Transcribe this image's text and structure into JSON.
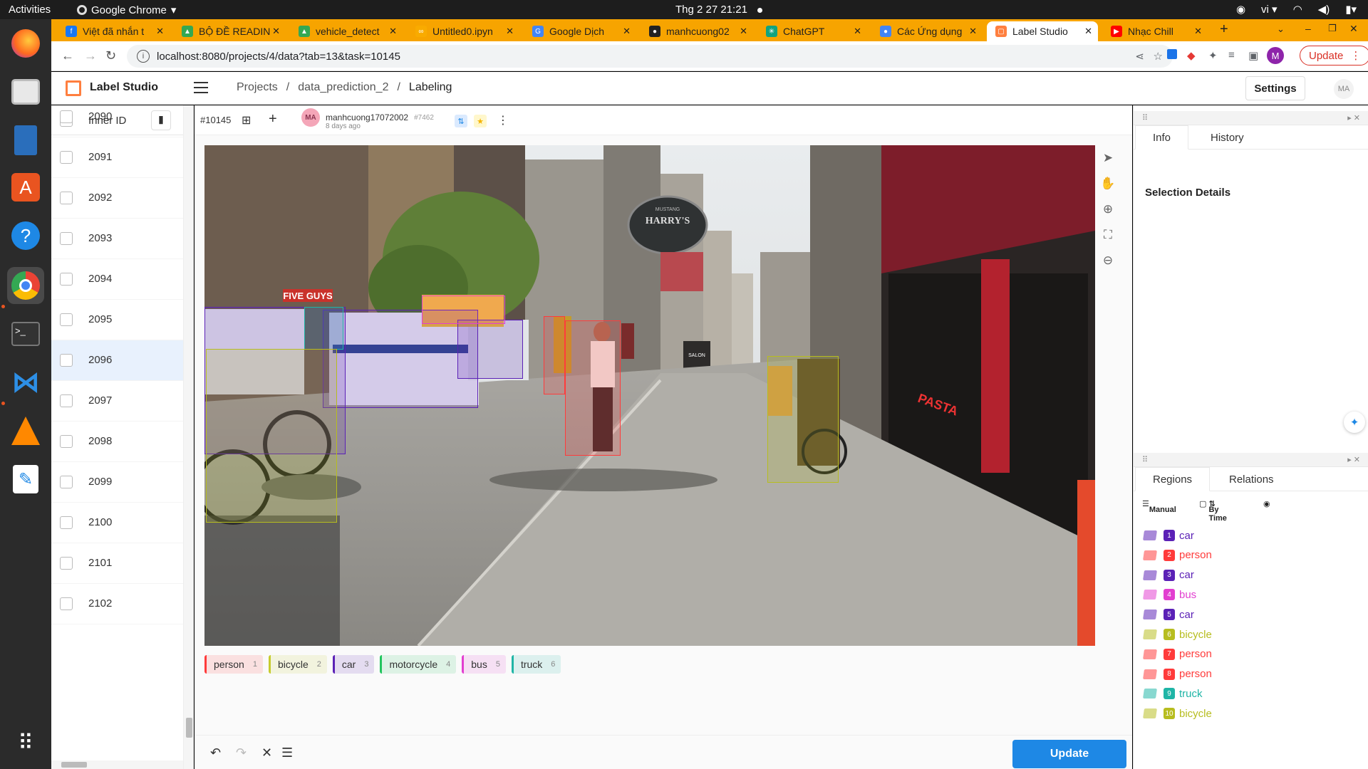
{
  "system": {
    "activities": "Activities",
    "app_name": "Google Chrome",
    "clock": "Thg 2 27  21:21",
    "lang": "vi"
  },
  "dock": [
    "firefox-icon",
    "files-icon",
    "libreoffice-writer-icon",
    "ubuntu-software-icon",
    "help-icon",
    "chrome-icon",
    "terminal-icon",
    "vscode-icon",
    "vlc-icon",
    "text-editor-icon",
    "app-grid-icon"
  ],
  "tabs": [
    {
      "title": "Việt đã nhắn t",
      "fav_color": "#1877f2",
      "fav": "f"
    },
    {
      "title": "BỘ ĐỀ READIN",
      "fav_color": "#34a853",
      "fav": "▲"
    },
    {
      "title": "vehicle_detect",
      "fav_color": "#34a853",
      "fav": "▲"
    },
    {
      "title": "Untitled0.ipyn",
      "fav_color": "#f9ab00",
      "fav": "∞"
    },
    {
      "title": "Google Dịch",
      "fav_color": "#4285f4",
      "fav": "G"
    },
    {
      "title": "manhcuong02",
      "fav_color": "#222222",
      "fav": "●"
    },
    {
      "title": "ChatGPT",
      "fav_color": "#10a37f",
      "fav": "✳"
    },
    {
      "title": "Các Ứng dụng",
      "fav_color": "#4285f4",
      "fav": "●"
    },
    {
      "title": "Label Studio",
      "fav_color": "#ff7f3f",
      "fav": "▢"
    },
    {
      "title": "Nhạc Chill",
      "fav_color": "#ff0000",
      "fav": "▶"
    }
  ],
  "toolbar": {
    "url": "localhost:8080/projects/4/data?tab=13&task=10145",
    "update_label": "Update",
    "profile_letter": "M"
  },
  "ls": {
    "title": "Label Studio",
    "breadcrumbs": [
      "Projects",
      "data_prediction_2",
      "Labeling"
    ],
    "settings": "Settings",
    "user_initials": "MA"
  },
  "tasklist": {
    "header": "Inner ID",
    "rows": [
      "2090",
      "2091",
      "2092",
      "2093",
      "2094",
      "2095",
      "2096",
      "2097",
      "2098",
      "2099",
      "2100",
      "2101",
      "2102"
    ],
    "selected": "2096"
  },
  "annotation": {
    "task_id": "#10145",
    "user": "manhcuong17072002",
    "annotation_id": "#7462",
    "user_initials": "MA",
    "time_ago": "8 days ago"
  },
  "image_text": {
    "sign": "HARRY'S",
    "sign_small": "MUSTANG",
    "shop1": "FIVE GUYS",
    "shop2": "SALON",
    "shop3": "PASTA"
  },
  "label_palette": [
    {
      "name": "person",
      "key": "1",
      "color": "#ff3b3b"
    },
    {
      "name": "bicycle",
      "key": "2",
      "color": "#c6cc2e"
    },
    {
      "name": "car",
      "key": "3",
      "color": "#5b21b6"
    },
    {
      "name": "motorcycle",
      "key": "4",
      "color": "#22c55e"
    },
    {
      "name": "bus",
      "key": "5",
      "color": "#e23fd0"
    },
    {
      "name": "truck",
      "key": "6",
      "color": "#1fb5a6"
    }
  ],
  "side": {
    "info_tab": "Info",
    "history_tab": "History",
    "selection_details": "Selection Details",
    "regions_tab": "Regions",
    "relations_tab": "Relations",
    "sort_manual": "Manual",
    "sort_time": "By Time"
  },
  "regions": [
    {
      "n": "1",
      "label": "car",
      "color": "#5b21b6"
    },
    {
      "n": "2",
      "label": "person",
      "color": "#ff3b3b"
    },
    {
      "n": "3",
      "label": "car",
      "color": "#5b21b6"
    },
    {
      "n": "4",
      "label": "bus",
      "color": "#e23fd0"
    },
    {
      "n": "5",
      "label": "car",
      "color": "#5b21b6"
    },
    {
      "n": "6",
      "label": "bicycle",
      "color": "#b7bd1f"
    },
    {
      "n": "7",
      "label": "person",
      "color": "#ff3b3b"
    },
    {
      "n": "8",
      "label": "person",
      "color": "#ff3b3b"
    },
    {
      "n": "9",
      "label": "truck",
      "color": "#1fb5a6"
    },
    {
      "n": "10",
      "label": "bicycle",
      "color": "#b7bd1f"
    }
  ],
  "footer": {
    "update": "Update"
  }
}
